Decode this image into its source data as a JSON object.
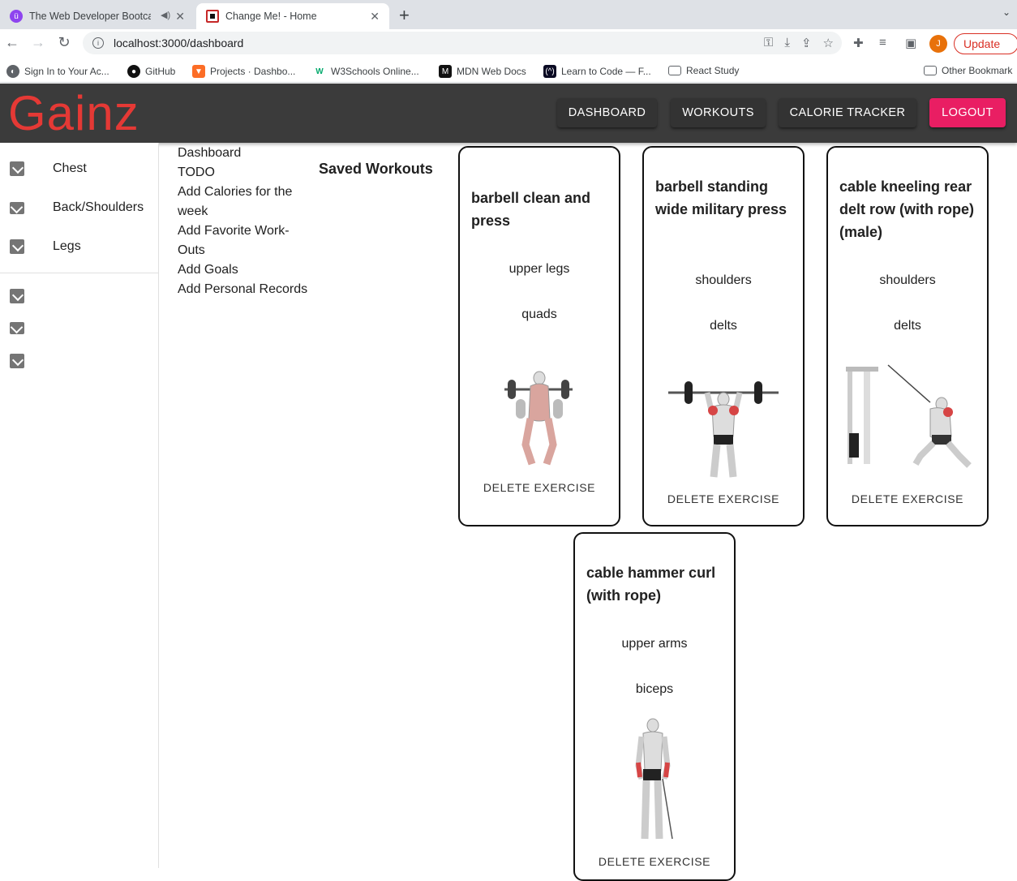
{
  "browser": {
    "tabs": [
      {
        "title": "The Web Developer Bootca"
      },
      {
        "title": "Change Me! - Home"
      }
    ],
    "url": "localhost:3000/dashboard",
    "update_label": "Update",
    "avatar_letter": "J",
    "bookmarks": [
      "Sign In to Your Ac...",
      "GitHub",
      "Projects · Dashbo...",
      "W3Schools Online...",
      "MDN Web Docs",
      "Learn to Code — F...",
      "React Study",
      "Other Bookmark"
    ]
  },
  "app": {
    "logo": "Gainz",
    "nav": {
      "dashboard": "DASHBOARD",
      "workouts": "WORKOUTS",
      "calorie": "CALORIE TRACKER",
      "logout": "LOGOUT"
    },
    "drawer": {
      "items": [
        "Chest",
        "Back/Shoulders",
        "Legs"
      ]
    },
    "todo": [
      "Dashboard",
      "TODO",
      "Add Calories for the week",
      "Add Favorite Work-Outs",
      "Add Goals",
      "Add Personal Records"
    ],
    "saved_title": "Saved Workouts",
    "exercises": [
      {
        "name": "barbell clean and press",
        "body_part": "upper legs",
        "target": "quads",
        "delete": "DELETE EXERCISE"
      },
      {
        "name": "barbell standing wide military press",
        "body_part": "shoulders",
        "target": "delts",
        "delete": "DELETE EXERCISE"
      },
      {
        "name": "cable kneeling rear delt row (with rope) (male)",
        "body_part": "shoulders",
        "target": "delts",
        "delete": "DELETE EXERCISE"
      },
      {
        "name": "cable hammer curl (with rope)",
        "body_part": "upper arms",
        "target": "biceps",
        "delete": "DELETE EXERCISE"
      }
    ],
    "colors": {
      "appbar": "#3b3b3b",
      "logo": "#e53935",
      "logout": "#e91e63"
    }
  }
}
